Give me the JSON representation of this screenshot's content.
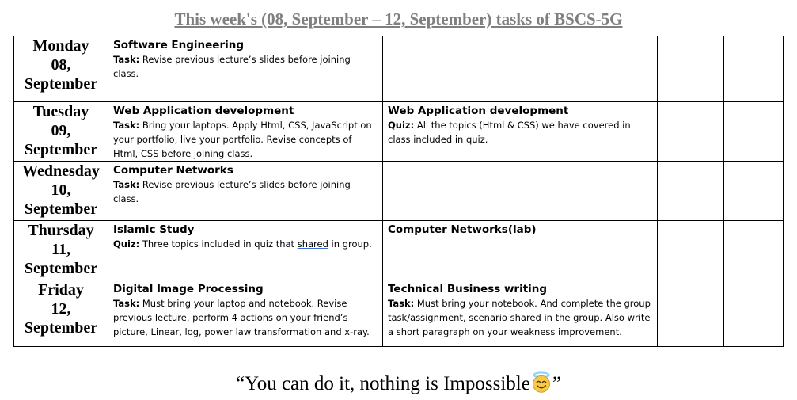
{
  "title": "This week's (08, September – 12, September) tasks of BSCS-5G",
  "days": [
    {
      "name": "Monday",
      "date": "08,",
      "month": "September",
      "slot1": {
        "subject": "Software Engineering",
        "label": "Task:",
        "text": " Revise previous lecture’s slides before joining class."
      },
      "slot2": {
        "subject": "",
        "label": "",
        "text": ""
      }
    },
    {
      "name": "Tuesday",
      "date": "09,",
      "month": "September",
      "slot1": {
        "subject": "Web Application development",
        "label": "Task:",
        "text": " Bring your laptops. Apply Html, CSS, JavaScript on your portfolio, live your portfolio. Revise concepts of Html, CSS before joining class."
      },
      "slot2": {
        "subject": "Web Application development",
        "label": "Quiz:",
        "text": " All the topics (Html & CSS) we have covered in class included in quiz."
      }
    },
    {
      "name": "Wednesday",
      "date": "10,",
      "month": "September",
      "slot1": {
        "subject": "Computer Networks",
        "label": "Task:",
        "text": " Revise previous lecture’s slides before joining class."
      },
      "slot2": {
        "subject": "",
        "label": "",
        "text": ""
      }
    },
    {
      "name": "Thursday",
      "date": "11,",
      "month": "September",
      "slot1": {
        "subject": "Islamic Study",
        "label": "Quiz:",
        "text_before": " Three topics included in quiz that ",
        "text_marked": "shared",
        "text_after": " in group."
      },
      "slot2": {
        "subject": "Computer Networks(lab)",
        "label": "",
        "text": ""
      }
    },
    {
      "name": "Friday",
      "date": "12,",
      "month": "September",
      "slot1": {
        "subject": "Digital Image Processing",
        "label": "Task:",
        "text": " Must bring your laptop and notebook. Revise previous lecture, perform 4 actions on your friend’s picture, Linear, log, power law transformation and x-ray."
      },
      "slot2": {
        "subject": "Technical Business writing",
        "label": "Task:",
        "text": " Must bring your notebook. And complete the group task/assignment, scenario shared in the group. Also write a short paragraph on your weakness improvement."
      }
    }
  ],
  "quote": {
    "open": "“You can do it, nothing is Impossible",
    "emoji_icon": "smiling-face-with-halo-icon",
    "close": "”"
  },
  "colors": {
    "title": "#7f7f7f",
    "border": "#000000",
    "spell_underline": "#3b6fd8",
    "emoji_face": "#f7c948",
    "emoji_halo": "#8fd3f4"
  }
}
